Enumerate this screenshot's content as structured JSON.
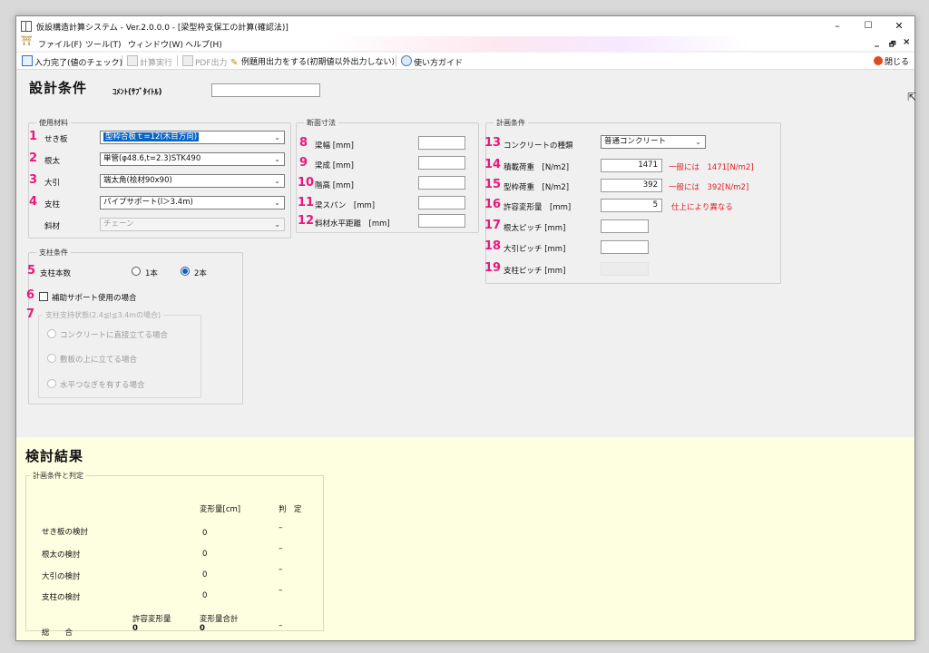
{
  "window": {
    "title": "仮設構造計算システム - Ver.2.0.0.0 - [梁型枠支保工の計算(確認法)]",
    "controls": {
      "minimize": "–",
      "maximize": "☐",
      "close": "✕"
    }
  },
  "menu": {
    "items": [
      "ファイル(F)",
      "ツール(T)",
      "ウィンドウ(W)",
      "ヘルプ(H)"
    ],
    "mdi": {
      "minimize": "_",
      "restore": "🗗",
      "close": "×"
    }
  },
  "toolbar": {
    "input_done": "入力完了(値のチェック)",
    "calc": "計算実行",
    "pdf": "PDF出力",
    "example_output": "例題用出力をする(初期値以外出力しない)",
    "guide": "使い方ガイド",
    "close": "閉じる"
  },
  "design": {
    "title": "設計条件",
    "comment_label": "ｺﾒﾝﾄ(ｻﾌﾞﾀｲﾄﾙ)",
    "comment_value": ""
  },
  "materials": {
    "group_label": "使用材料",
    "rows": [
      {
        "num": "1",
        "label": "せき板",
        "value": "型枠合板ｔ=12(木目方向)"
      },
      {
        "num": "2",
        "label": "根太",
        "value": "単管(φ48.6,t=2.3)STK490"
      },
      {
        "num": "3",
        "label": "大引",
        "value": "端太角(桧材90x90)"
      },
      {
        "num": "4",
        "label": "支柱",
        "value": "パイプサポート(l＞3.4m)"
      },
      {
        "num": "",
        "label": "斜材",
        "value": "チェーン"
      }
    ]
  },
  "dimensions": {
    "group_label": "断面寸法",
    "rows": [
      {
        "num": "8",
        "label": "梁幅 [mm]",
        "value": ""
      },
      {
        "num": "9",
        "label": "梁成 [mm]",
        "value": ""
      },
      {
        "num": "10",
        "label": "階高 [mm]",
        "value": ""
      },
      {
        "num": "11",
        "label": "梁スパン　[mm]",
        "value": ""
      },
      {
        "num": "12",
        "label": "斜材水平距離　[mm]",
        "value": ""
      }
    ]
  },
  "plan": {
    "group_label": "計画条件",
    "concrete": {
      "num": "13",
      "label": "コンクリートの種類",
      "value": "普通コンクリート"
    },
    "rows": [
      {
        "num": "14",
        "label": "積載荷重　[N/m2]",
        "value": "1471",
        "note": "一般には　1471[N/m2]"
      },
      {
        "num": "15",
        "label": "型枠荷重　[N/m2]",
        "value": "392",
        "note": "一般には　392[N/m2]"
      },
      {
        "num": "16",
        "label": "許容変形量　[mm]",
        "value": "5",
        "note": "仕上により異なる"
      },
      {
        "num": "17",
        "label": "根太ピッチ [mm]",
        "value": "",
        "note": ""
      },
      {
        "num": "18",
        "label": "大引ピッチ [mm]",
        "value": "",
        "note": ""
      },
      {
        "num": "19",
        "label": "支柱ピッチ [mm]",
        "value": "",
        "note": ""
      }
    ]
  },
  "support": {
    "group_label": "支柱条件",
    "count": {
      "num": "5",
      "label": "支柱本数",
      "options": [
        "1本",
        "2本"
      ],
      "selected": "2本"
    },
    "aux": {
      "num": "6",
      "label": "補助サポート使用の場合",
      "checked": false
    },
    "state": {
      "num": "7",
      "group_label": "支柱支持状態(2.4≦l≦3.4mの場合)",
      "options": [
        "コンクリートに直接立てる場合",
        "敷板の上に立てる場合",
        "水平つなぎを有する場合"
      ]
    }
  },
  "results": {
    "title": "検討結果",
    "group_label": "計画条件と判定",
    "col_deform": "変形量[cm]",
    "col_judge": "判　定",
    "rows": [
      {
        "label": "せき板の検討",
        "value": "0",
        "judge": "–"
      },
      {
        "label": "根太の検討",
        "value": "0",
        "judge": "–"
      },
      {
        "label": "大引の検討",
        "value": "0",
        "judge": "–"
      },
      {
        "label": "支柱の検討",
        "value": "0",
        "judge": "–"
      }
    ],
    "total": {
      "label": "総　　合",
      "allow_label": "許容変形量",
      "sum_label": "変形量合計",
      "allow_value": "0",
      "sum_value": "0",
      "judge": "–"
    }
  }
}
